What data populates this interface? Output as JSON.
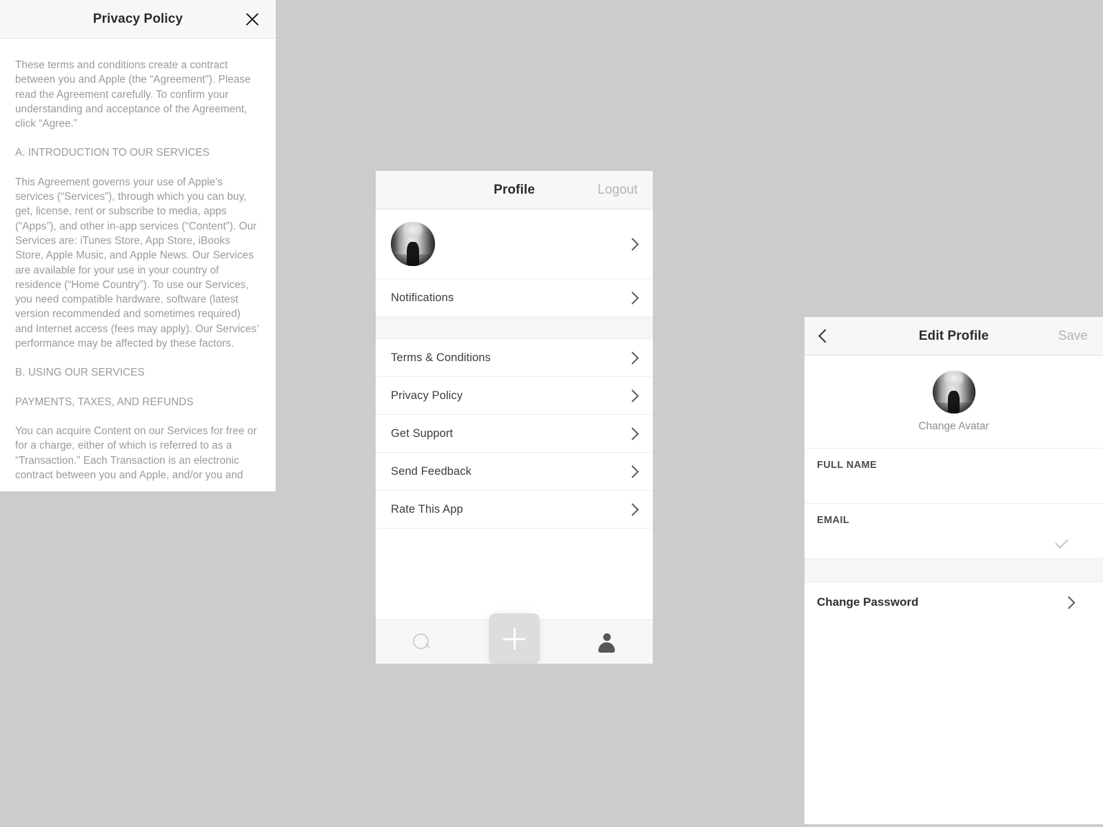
{
  "background_color": "#cccccc",
  "privacy_screen": {
    "title": "Privacy Policy",
    "close_icon": "close-icon",
    "paragraphs": [
      {
        "type": "paragraph",
        "text": "These terms and conditions create a contract between you and Apple (the “Agreement”). Please read the Agreement carefully. To confirm your understanding and acceptance of the Agreement, click “Agree.”"
      },
      {
        "type": "heading",
        "text": "A. INTRODUCTION TO OUR SERVICES"
      },
      {
        "type": "paragraph",
        "text": "This Agreement governs your use of Apple’s services (“Services”), through which you can buy, get, license, rent or subscribe to media, apps (“Apps”), and other in-app services (“Content”). Our Services are: iTunes Store, App Store, iBooks Store, Apple Music, and Apple News. Our Services are available for your use in your country of residence (“Home Country”). To use our Services, you need compatible hardware, software (latest version recommended and sometimes required) and Internet access (fees may apply). Our Services’ performance may be affected by these factors."
      },
      {
        "type": "heading",
        "text": "B. USING OUR SERVICES"
      },
      {
        "type": "heading",
        "text": "PAYMENTS, TAXES, AND REFUNDS"
      },
      {
        "type": "paragraph",
        "text": "You can acquire Content on our Services for free or for a charge, either of which is referred to as a “Transaction.” Each Transaction is an electronic contract between you and Apple, and/or you and"
      }
    ]
  },
  "profile_screen": {
    "title": "Profile",
    "logout_label": "Logout",
    "avatar_row": {
      "name": " ",
      "email": " ",
      "avatar_icon": "avatar",
      "chevron_icon": "chevron-right-icon"
    },
    "group_one": [
      {
        "label": "Notifications",
        "chevron_icon": "chevron-right-icon"
      }
    ],
    "group_two": [
      {
        "label": "Terms & Conditions",
        "chevron_icon": "chevron-right-icon"
      },
      {
        "label": "Privacy Policy",
        "chevron_icon": "chevron-right-icon"
      },
      {
        "label": "Get Support",
        "chevron_icon": "chevron-right-icon"
      },
      {
        "label": "Send Feedback",
        "chevron_icon": "chevron-right-icon"
      },
      {
        "label": "Rate This App",
        "chevron_icon": "chevron-right-icon"
      }
    ],
    "tabbar": {
      "tabs": [
        {
          "icon": "search-icon",
          "active": false
        },
        {
          "icon": "plus-icon",
          "active": false
        },
        {
          "icon": "person-icon",
          "active": true
        }
      ]
    }
  },
  "edit_profile_screen": {
    "title": "Edit Profile",
    "back_icon": "chevron-left-icon",
    "save_label": "Save",
    "avatar_icon": "avatar",
    "change_avatar_label": "Change Avatar",
    "fields": [
      {
        "label": "FULL NAME",
        "value": "",
        "has_check": false
      },
      {
        "label": "EMAIL",
        "value": "",
        "has_check": true,
        "check_icon": "check-icon"
      }
    ],
    "change_password": {
      "label": "Change Password",
      "chevron_icon": "chevron-right-icon"
    }
  }
}
